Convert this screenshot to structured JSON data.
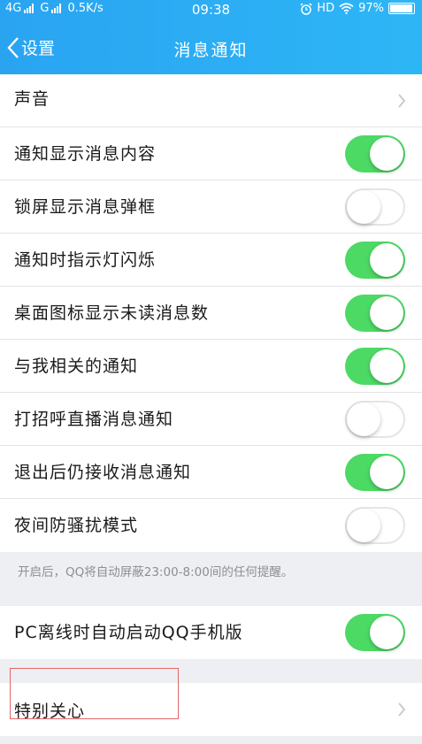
{
  "status_bar": {
    "network1": "4G",
    "network2": "G",
    "speed": "0.5K/s",
    "time": "09:38",
    "alarm_icon": "alarm-icon",
    "hd": "HD",
    "wifi_icon": "wifi-icon",
    "battery": "97%",
    "battery_level": 0.97
  },
  "header": {
    "back_label": "设置",
    "title": "消息通知",
    "color": "#2aa4f1"
  },
  "settings": {
    "sound": {
      "label": "声音"
    },
    "toggles": [
      {
        "label": "通知显示消息内容",
        "on": true
      },
      {
        "label": "锁屏显示消息弹框",
        "on": false
      },
      {
        "label": "通知时指示灯闪烁",
        "on": true
      },
      {
        "label": "桌面图标显示未读消息数",
        "on": true
      },
      {
        "label": "与我相关的通知",
        "on": true
      },
      {
        "label": "打招呼直播消息通知",
        "on": false
      },
      {
        "label": "退出后仍接收消息通知",
        "on": true
      },
      {
        "label": "夜间防骚扰模式",
        "on": false
      }
    ],
    "night_mode_note": "开启后，QQ将自动屏蔽23:00-8:00间的任何提醒。",
    "pc_offline": {
      "label": "PC离线时自动启动QQ手机版",
      "on": true
    },
    "special_care": {
      "label": "特别关心"
    }
  },
  "colors": {
    "toggle_on": "#4cd964",
    "highlight_border": "#e26565"
  }
}
